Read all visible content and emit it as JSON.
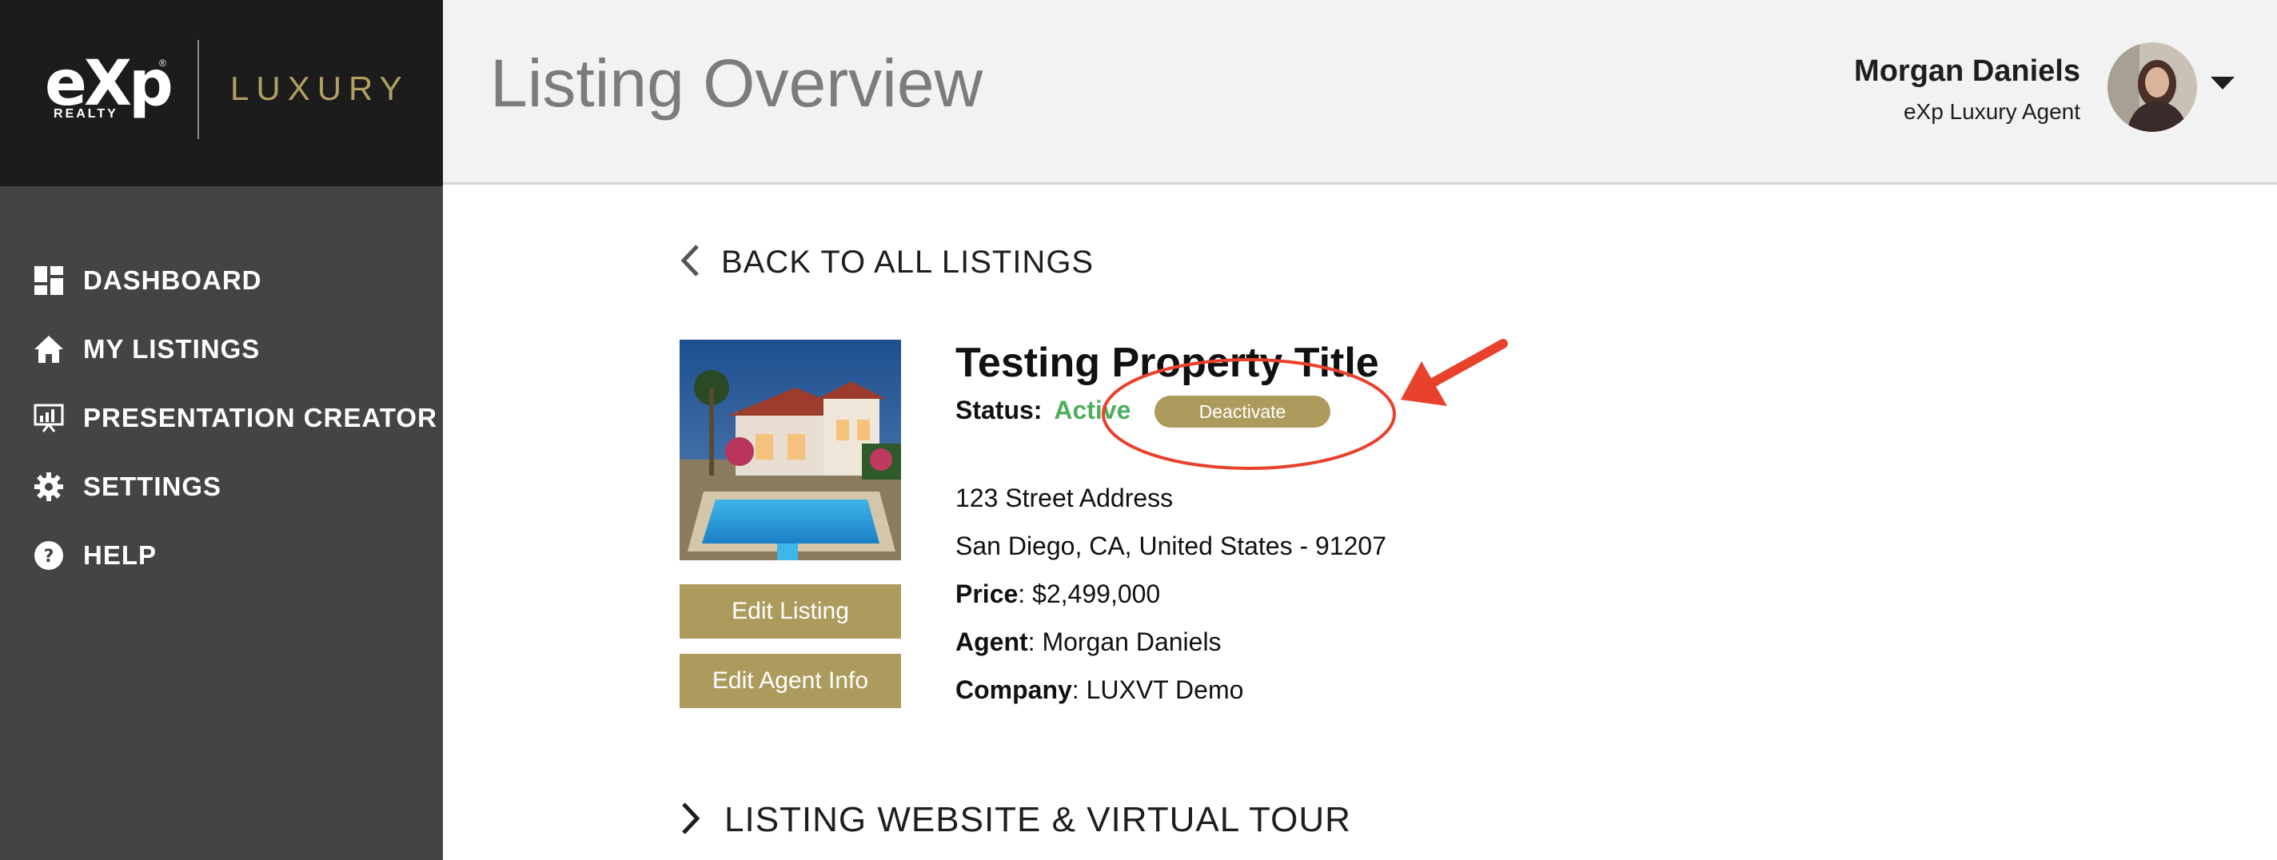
{
  "brand": {
    "logo_main": "eXp",
    "logo_sub": "REALTY",
    "logo_mark": "®",
    "logo_luxury": "LUXURY"
  },
  "sidebar": {
    "items": [
      {
        "label": "DASHBOARD",
        "icon": "dashboard-grid-icon"
      },
      {
        "label": "MY LISTINGS",
        "icon": "home-icon"
      },
      {
        "label": "PRESENTATION CREATOR",
        "icon": "presentation-chart-icon"
      },
      {
        "label": "SETTINGS",
        "icon": "gear-icon"
      },
      {
        "label": "HELP",
        "icon": "question-circle-icon"
      }
    ]
  },
  "header": {
    "title": "Listing Overview",
    "user_name": "Morgan Daniels",
    "user_role": "eXp Luxury Agent"
  },
  "content": {
    "back_label": "BACK TO ALL LISTINGS",
    "edit_listing_label": "Edit Listing",
    "edit_agent_label": "Edit Agent Info",
    "property_title": "Testing Property Title",
    "status_label": "Status:",
    "status_value": "Active",
    "deactivate_label": "Deactivate",
    "address_line1": "123 Street Address",
    "address_line2": "San Diego, CA, United States - 91207",
    "price_label": "Price",
    "price_value": ": $2,499,000",
    "agent_label": "Agent",
    "agent_value": ": Morgan Daniels",
    "company_label": "Company",
    "company_value": ": LUXVT Demo",
    "section_label": "LISTING WEBSITE & VIRTUAL TOUR"
  },
  "colors": {
    "sidebar_bg": "#444444",
    "logo_bg": "#1c1c1c",
    "gold": "#ad9b5e",
    "active_green": "#4fae5e",
    "annotation_red": "#e8412c"
  }
}
